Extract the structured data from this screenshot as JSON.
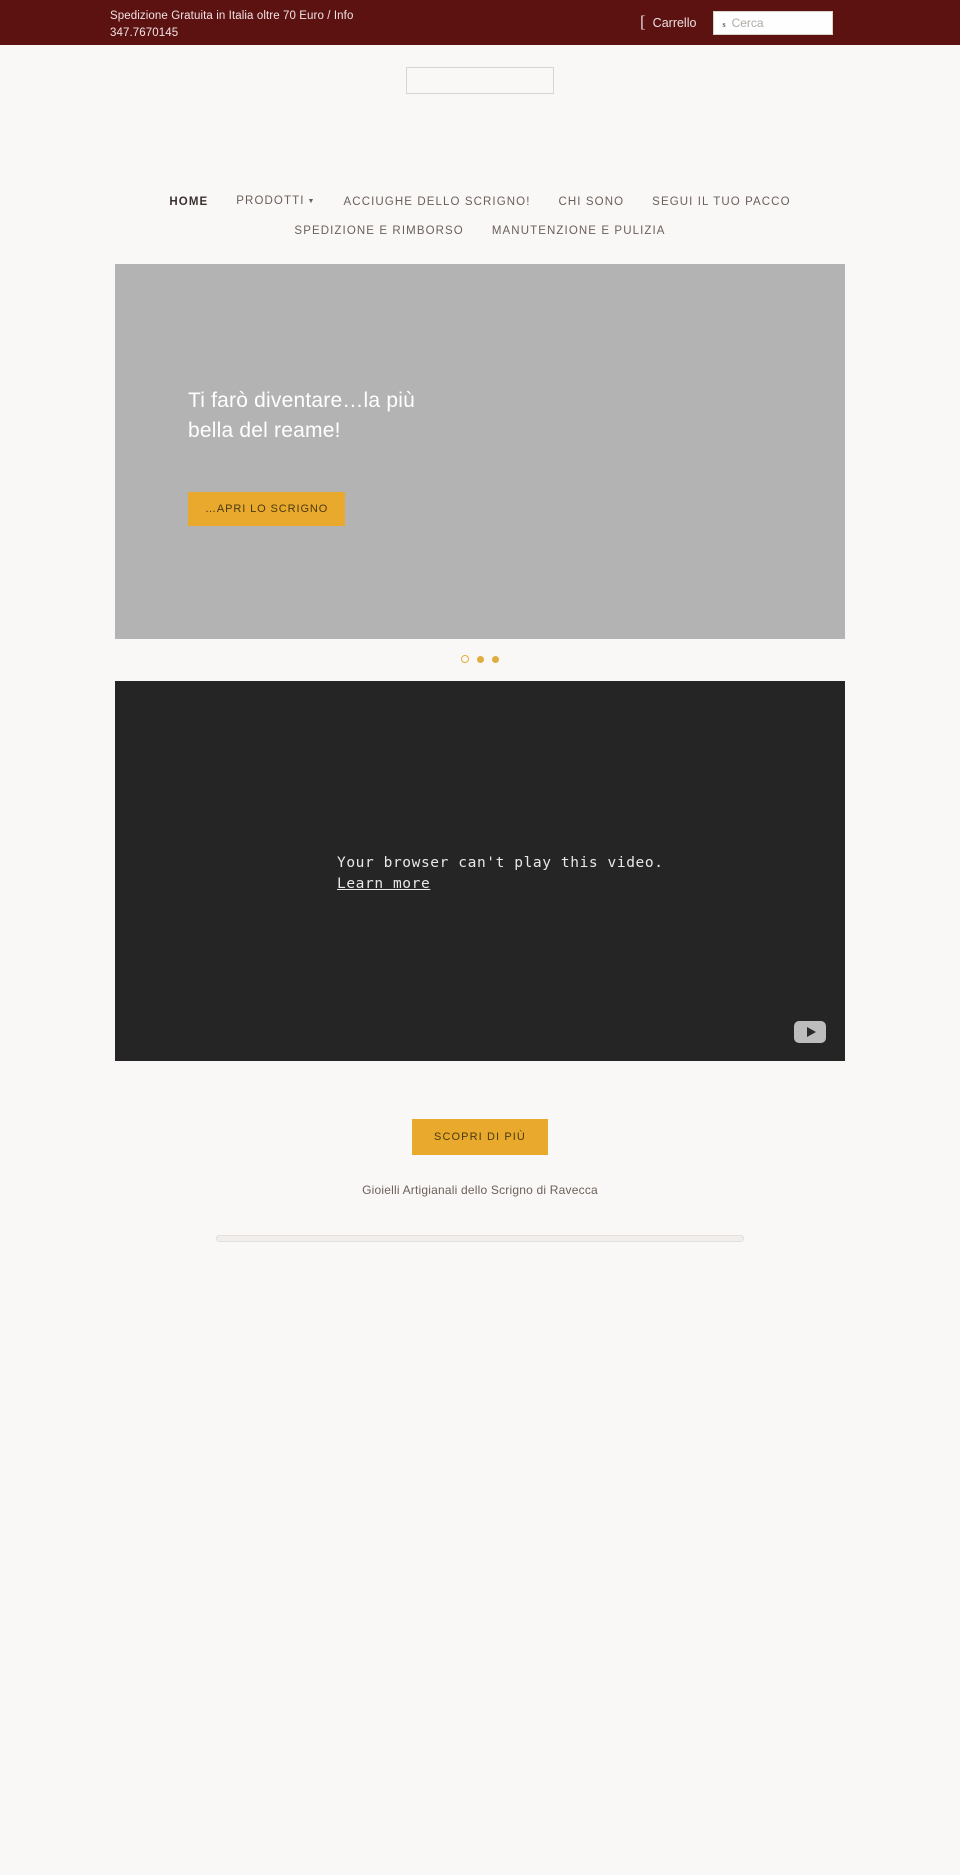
{
  "announcement": {
    "message": "Spedizione Gratuita in Italia oltre 70 Euro / Info 347.7670145",
    "cart_label": "Carrello",
    "cart_icon": "cart-icon",
    "search_placeholder": "Cerca",
    "search_value": "",
    "search_icon": "search-icon",
    "search_glyph": "s",
    "cart_glyph": "["
  },
  "header": {
    "logo_alt": "",
    "site_name": "Gioielli Artigianali dello Scrigno di Ravecca"
  },
  "nav": {
    "row1": [
      {
        "label": "Home",
        "active": true,
        "has_dropdown": false
      },
      {
        "label": "Prodotti",
        "active": false,
        "has_dropdown": true
      },
      {
        "label": "Acciughe dello Scrigno!",
        "active": false,
        "has_dropdown": false
      },
      {
        "label": "Chi Sono",
        "active": false,
        "has_dropdown": false
      },
      {
        "label": "Segui il tuo pacco",
        "active": false,
        "has_dropdown": false
      }
    ],
    "row2": [
      {
        "label": "Spedizione e Rimborso",
        "active": false,
        "has_dropdown": false
      },
      {
        "label": "Manutenzione e Pulizia",
        "active": false,
        "has_dropdown": false
      }
    ],
    "caret": "▼"
  },
  "hero": {
    "title_line1": "Ti farò diventare…la più",
    "title_line2": "bella del reame!",
    "button_label": "…Apri lo Scrigno",
    "slides_count": 3,
    "active_slide": 1
  },
  "video": {
    "error_line1": "Your browser can't play this video.",
    "error_link": "Learn more",
    "play_label": "play-button"
  },
  "cta": {
    "button_label": "Scopri di più",
    "caption": "Gioielli Artigianali dello Scrigno di Ravecca"
  },
  "colors": {
    "topbar_bg": "#5d1212",
    "page_bg": "#faf8f6",
    "accent": "#e8a92c",
    "hero_placeholder": "#b3b3b3",
    "video_bg": "#252525",
    "nav_text": "#6b5f5a"
  }
}
